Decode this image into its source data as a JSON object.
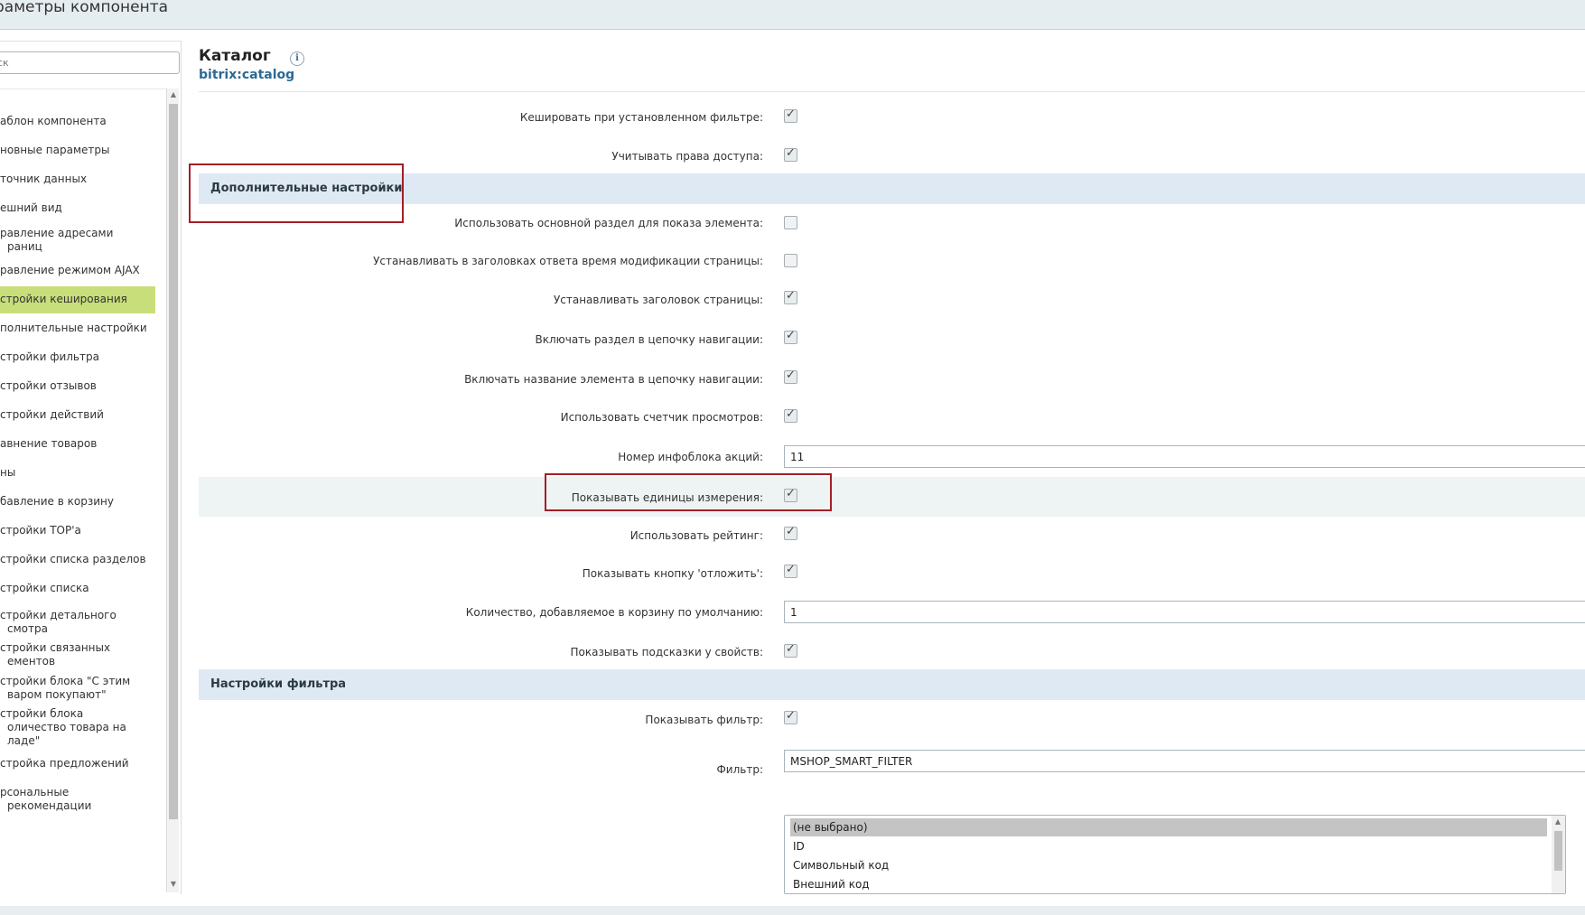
{
  "window": {
    "title": "раметры компонента"
  },
  "sidebar": {
    "search_placeholder": "ск",
    "items": [
      {
        "label": "аблон компонента"
      },
      {
        "label": "новные параметры"
      },
      {
        "label": "точник данных"
      },
      {
        "label": "ешний вид"
      },
      {
        "label": "равление адресами\nраниц"
      },
      {
        "label": "равление режимом AJAX"
      },
      {
        "label": "стройки кеширования",
        "active": true
      },
      {
        "label": "полнительные настройки"
      },
      {
        "label": "стройки фильтра"
      },
      {
        "label": "стройки отзывов"
      },
      {
        "label": "стройки действий"
      },
      {
        "label": "авнение товаров"
      },
      {
        "label": "ны"
      },
      {
        "label": "бавление в корзину"
      },
      {
        "label": "стройки TOP'а"
      },
      {
        "label": "стройки списка разделов"
      },
      {
        "label": "стройки списка"
      },
      {
        "label": "стройки детального\nсмотра"
      },
      {
        "label": "стройки связанных\nементов"
      },
      {
        "label": "стройки блока \"С этим\nваром покупают\""
      },
      {
        "label": "стройки блока\nоличество товара на\nладе\""
      },
      {
        "label": "стройка предложений"
      },
      {
        "label": "рсональные рекомендации"
      }
    ]
  },
  "content": {
    "title": "Каталог",
    "code": "bitrix:catalog",
    "info_icon": "info-icon",
    "rows": {
      "cache_filter": {
        "label": "Кешировать при установленном фильтре:",
        "checked": true
      },
      "access_rights": {
        "label": "Учитывать права доступа:",
        "checked": true
      },
      "use_main_section": {
        "label": "Использовать основной раздел для показа элемента:",
        "checked": false
      },
      "last_modified": {
        "label": "Устанавливать в заголовках ответа время модификации страницы:",
        "checked": false
      },
      "set_title": {
        "label": "Устанавливать заголовок страницы:",
        "checked": true
      },
      "section_chain": {
        "label": "Включать раздел в цепочку навигации:",
        "checked": true
      },
      "element_chain": {
        "label": "Включать название элемента в цепочку навигации:",
        "checked": true
      },
      "view_counter": {
        "label": "Использовать счетчик просмотров:",
        "checked": true
      },
      "promo_iblock": {
        "label": "Номер инфоблока акций:",
        "value": "11"
      },
      "show_measure": {
        "label": "Показывать единицы измерения:",
        "checked": true
      },
      "use_rating": {
        "label": "Использовать рейтинг:",
        "checked": true
      },
      "show_delay": {
        "label": "Показывать кнопку 'отложить':",
        "checked": true
      },
      "default_quantity": {
        "label": "Количество, добавляемое в корзину по умолчанию:",
        "value": "1"
      },
      "show_hints": {
        "label": "Показывать подсказки у свойств:",
        "checked": true
      },
      "show_filter": {
        "label": "Показывать фильтр:",
        "checked": true
      },
      "filter_name": {
        "label": "Фильтр:",
        "value": "MSHOP_SMART_FILTER"
      }
    },
    "sections": {
      "extra": "Дополнительные настройки",
      "filter": "Настройки фильтра"
    },
    "filter_fields": [
      "(не выбрано)",
      "ID",
      "Символьный код",
      "Внешний код"
    ]
  },
  "colors": {
    "active_item": "#c8de7a",
    "section_bg": "#dfe9f4",
    "highlight_box": "#a31f25",
    "link": "#2b6a95"
  }
}
